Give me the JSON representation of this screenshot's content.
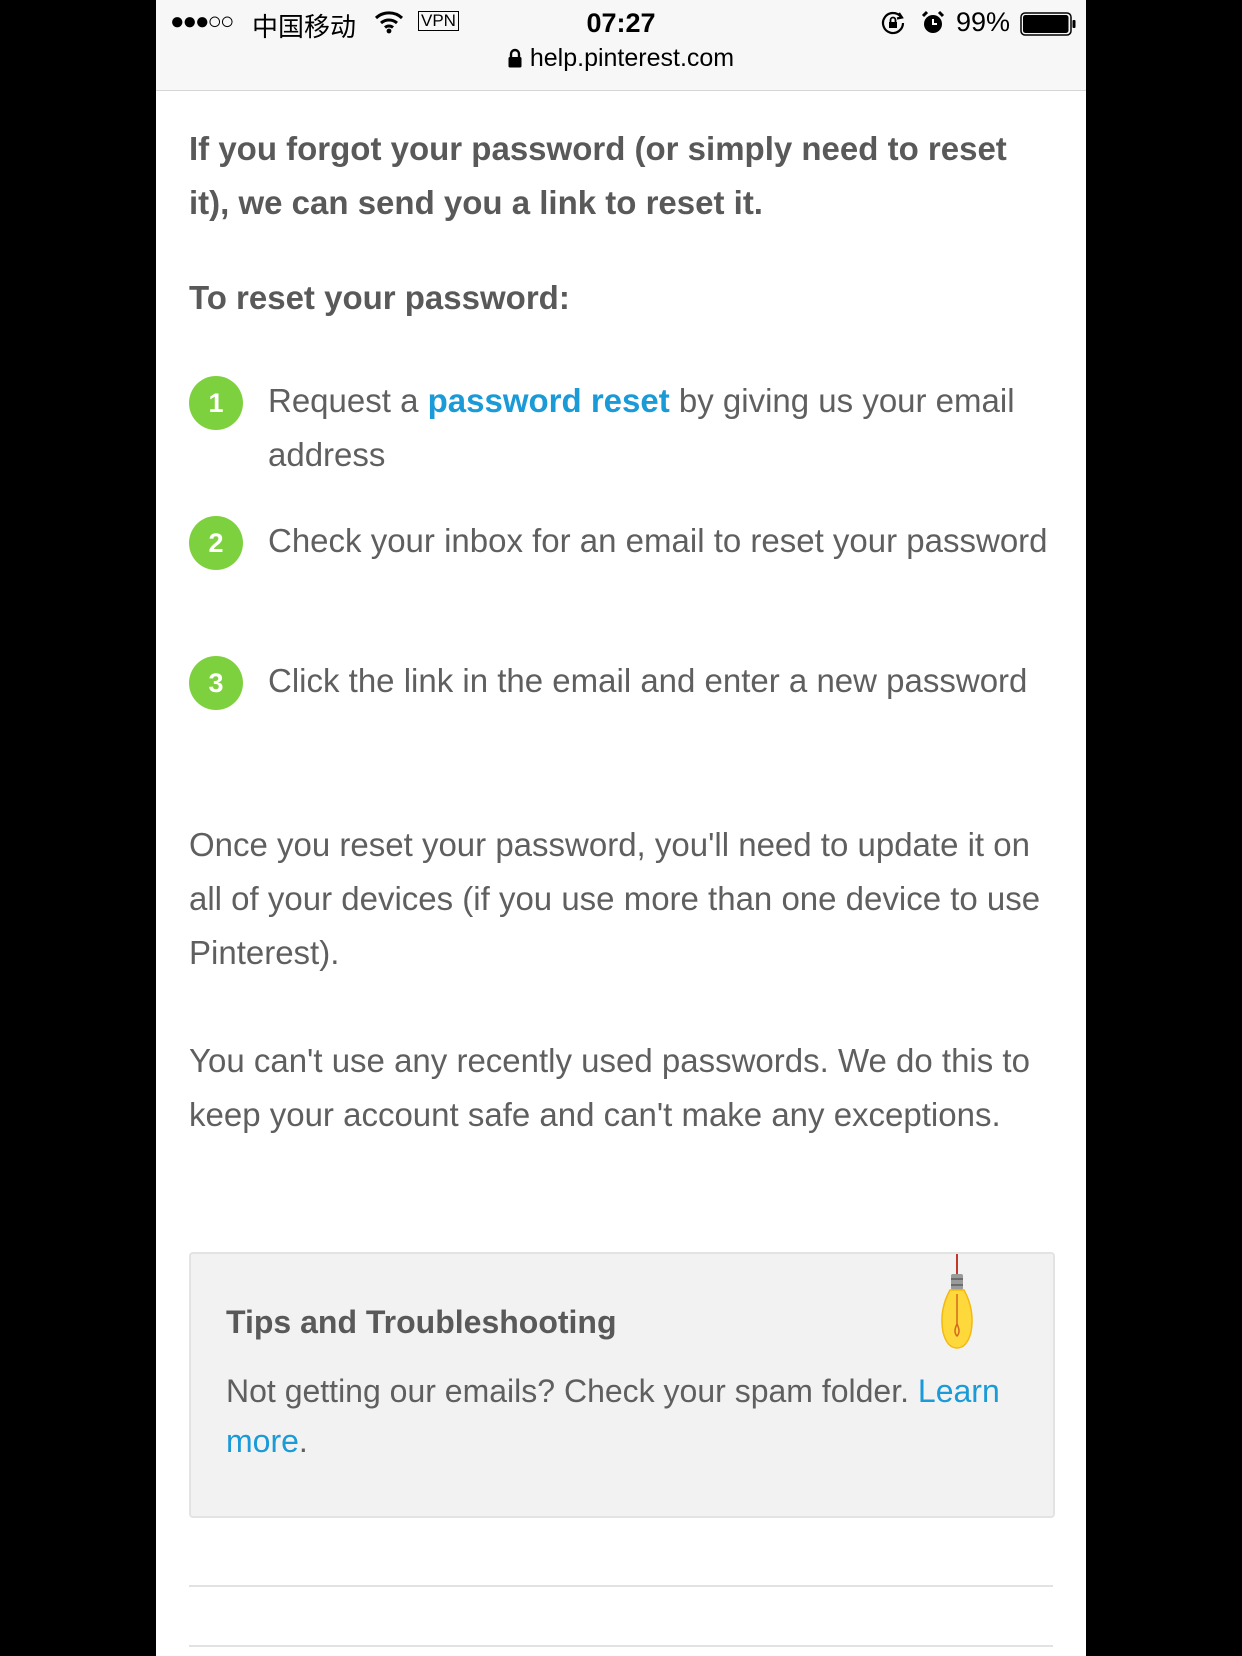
{
  "status_bar": {
    "signal": "●●●○○",
    "carrier": "中国移动",
    "vpn": "VPN",
    "time": "07:27",
    "battery_percent": "99%",
    "battery_level": 0.99,
    "url": "help.pinterest.com"
  },
  "article": {
    "intro": "If you forgot your password (or simply need to reset it), we can send you a link to reset it.",
    "subheading": "To reset your password:",
    "steps": [
      {
        "number": "1",
        "text_before": "Request a ",
        "link": "password reset",
        "text_after": " by giving us your email address"
      },
      {
        "number": "2",
        "text": "Check your inbox for an email to reset your password"
      },
      {
        "number": "3",
        "text": "Click the link in the email and enter a new password"
      }
    ],
    "para_devices": "Once you reset your password, you'll need to update it on all of your devices (if you use more than one device to use Pinterest).",
    "para_recent": "You can't use any recently used passwords. We do this to keep your account safe and can't make any exceptions."
  },
  "tips": {
    "title": "Tips and Troubleshooting",
    "body": "Not getting our emails? Check your spam folder. ",
    "link": "Learn more",
    "trailing": "."
  },
  "colors": {
    "step_badge": "#7ed13e",
    "link": "#1a9ad6",
    "text": "#5f5f5f"
  }
}
